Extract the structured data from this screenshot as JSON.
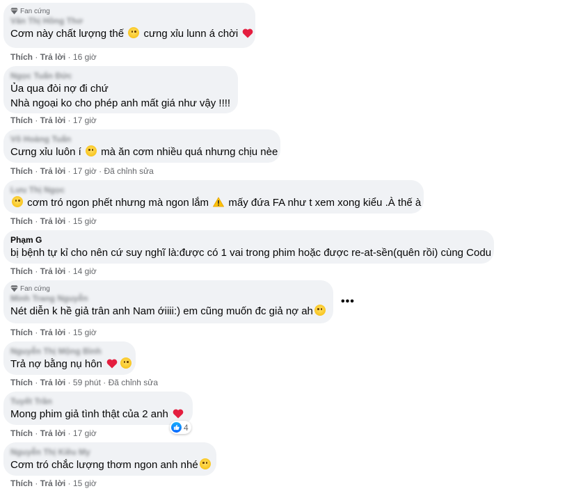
{
  "actions": {
    "like": "Thích",
    "reply": "Trả lời",
    "edited": "Đã chỉnh sửa"
  },
  "comments": [
    {
      "badge": "Fan cứng",
      "author": "Văn Thị Hồng Thơ",
      "lines": [
        "Cơm này chất lượng thế",
        "cưng xỉu lunn á chời"
      ],
      "time": "16 giờ"
    },
    {
      "author": "Ngọc Tuấn Đức",
      "lines": [
        "Ủa qua đòi nợ đi chứ",
        "Nhà ngoại ko cho phép anh mất giá như vậy !!!!"
      ],
      "time": "17 giờ"
    },
    {
      "author": "Võ Hoàng Tuấn",
      "lines": [
        "Cưng xỉu luôn í",
        "mà ăn cơm nhiều quá nhưng chịu nèe"
      ],
      "time": "17 giờ"
    },
    {
      "author": "Lưu Thị Ngọc",
      "lines": [
        "cơm tró ngon phết nhưng mà ngon lắm",
        "mấy đứa FA như t xem xong kiểu .À thế à"
      ],
      "time": "15 giờ"
    },
    {
      "author": "Phạm G",
      "lines": [
        "bị bệnh tự kỉ cho nên cứ suy nghĩ là:được có 1 vai trong phim hoặc được re-at-sền(quên rồi) cùng Codu"
      ],
      "time": "14 giờ"
    },
    {
      "badge": "Fan cứng",
      "author": "Minh Trang Nguyễn",
      "lines": [
        "Nét diễn k hề giả trân anh Nam ớiiii:) em cũng muốn đc giả nợ ah"
      ],
      "time": "15 giờ"
    },
    {
      "author": "Nguyễn Thị Mộng Bình",
      "lines": [
        "Trả nợ bằng nụ hôn"
      ],
      "time": "59 phút"
    },
    {
      "author": "Tuyết Trần",
      "lines": [
        "Mong phim giả tình thật của 2 anh"
      ],
      "time": "17 giờ",
      "reaction_count": "4"
    },
    {
      "author": "Nguyễn Thị Kiều My",
      "lines": [
        "Cơm tró chắc lượng thơm ngon anh nhé"
      ],
      "time": "15 giờ"
    }
  ],
  "icons": {
    "diamond": "diamond-icon",
    "grin": "grinning-emoji",
    "heart": "red-heart-emoji",
    "laugh": "laughing-emoji",
    "smile": "smiling-emoji",
    "warning": "warning-emoji",
    "grimace": "grimacing-emoji",
    "sad": "sad-emoji",
    "like": "like-thumb-icon",
    "more": "more-options-icon"
  },
  "colors": {
    "bubble": "#f0f2f5",
    "meta": "#65676b",
    "heart": "#e41e3f",
    "like": "#0866ff"
  }
}
